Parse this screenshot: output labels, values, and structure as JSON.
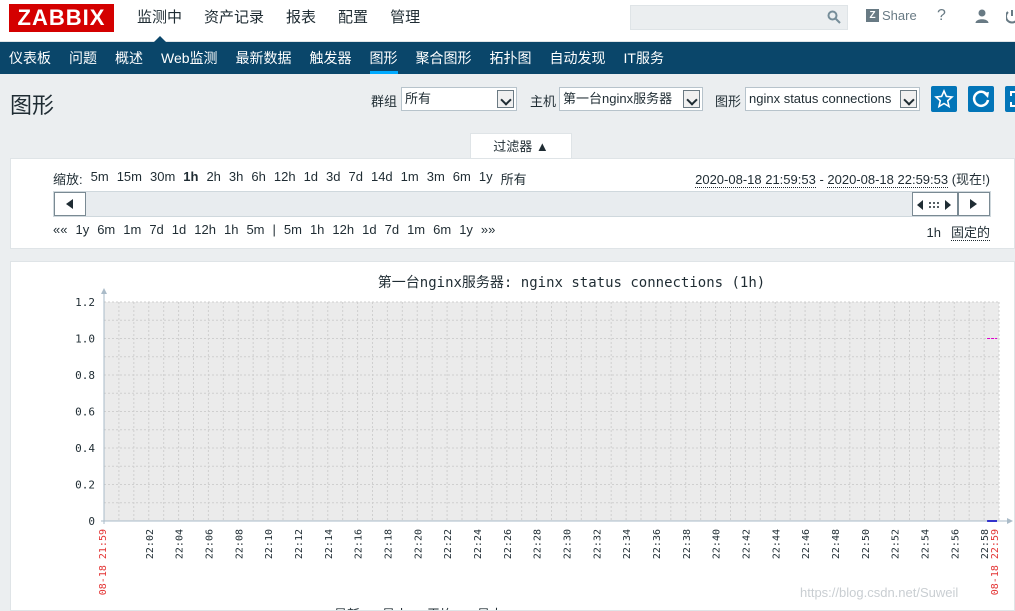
{
  "logo": "ZABBIX",
  "main_menu": [
    "监测中",
    "资产记录",
    "报表",
    "配置",
    "管理"
  ],
  "search": {
    "value": "",
    "placeholder": ""
  },
  "header_links": {
    "share": "Share",
    "help": "?"
  },
  "sub_menu": [
    "仪表板",
    "问题",
    "概述",
    "Web监测",
    "最新数据",
    "触发器",
    "图形",
    "聚合图形",
    "拓扑图",
    "自动发现",
    "IT服务"
  ],
  "page": {
    "title": "图形"
  },
  "filters": {
    "group_label": "群组",
    "group_value": "所有",
    "host_label": "主机",
    "host_value": "第一台nginx服务器",
    "graph_label": "图形",
    "graph_value": "nginx status connections"
  },
  "filter_tab": "过滤器 ▲",
  "zoom": {
    "label": "缩放:",
    "options": [
      "5m",
      "15m",
      "30m",
      "1h",
      "2h",
      "3h",
      "6h",
      "12h",
      "1d",
      "3d",
      "7d",
      "14d",
      "1m",
      "3m",
      "6m",
      "1y",
      "所有"
    ]
  },
  "time_range": {
    "from": "2020-08-18 21:59:53",
    "sep": " - ",
    "to": "2020-08-18 22:59:53",
    "now": " (现在!)"
  },
  "nav": {
    "back": [
      "««",
      "1y",
      "6m",
      "1m",
      "7d",
      "1d",
      "12h",
      "1h",
      "5m"
    ],
    "sep": "|",
    "forward": [
      "5m",
      "1h",
      "12h",
      "1d",
      "7d",
      "1m",
      "6m",
      "1y",
      "»»"
    ],
    "period": "1h",
    "fixed": "固定的"
  },
  "colors": {
    "accent": "#0a466a",
    "highlight": "#00aaff",
    "brand": "#d40000",
    "button": "#0275b8",
    "series": "#dd00cc",
    "series2": "#3333cc",
    "edge_label": "#e33434"
  },
  "chart_data": {
    "type": "line",
    "title": "第一台nginx服务器: nginx status connections (1h)",
    "y_ticks": [
      "0",
      "0.2",
      "0.4",
      "0.6",
      "0.8",
      "1.0",
      "1.2"
    ],
    "ylim": [
      0,
      1.2
    ],
    "x_start_label": "08-18 21:59",
    "x_end_label": "08-18 22:59",
    "x_ticks": [
      "22:02",
      "22:04",
      "22:06",
      "22:08",
      "22:10",
      "22:12",
      "22:14",
      "22:16",
      "22:18",
      "22:20",
      "22:22",
      "22:24",
      "22:26",
      "22:28",
      "22:30",
      "22:32",
      "22:34",
      "22:36",
      "22:38",
      "22:40",
      "22:42",
      "22:44",
      "22:46",
      "22:48",
      "22:50",
      "22:52",
      "22:54",
      "22:56",
      "22:58"
    ],
    "series": [
      {
        "color": "#dd00cc",
        "values": [
          1.0,
          1.0
        ],
        "x": [
          "22:58",
          "22:59"
        ]
      },
      {
        "color": "#3333cc",
        "values": [
          0,
          0
        ],
        "x": [
          "22:58",
          "22:59"
        ]
      }
    ],
    "grid": true,
    "legend_partial": [
      "最新",
      "最小",
      "平均",
      "最大"
    ]
  },
  "watermark": "https://blog.csdn.net/Suweil"
}
